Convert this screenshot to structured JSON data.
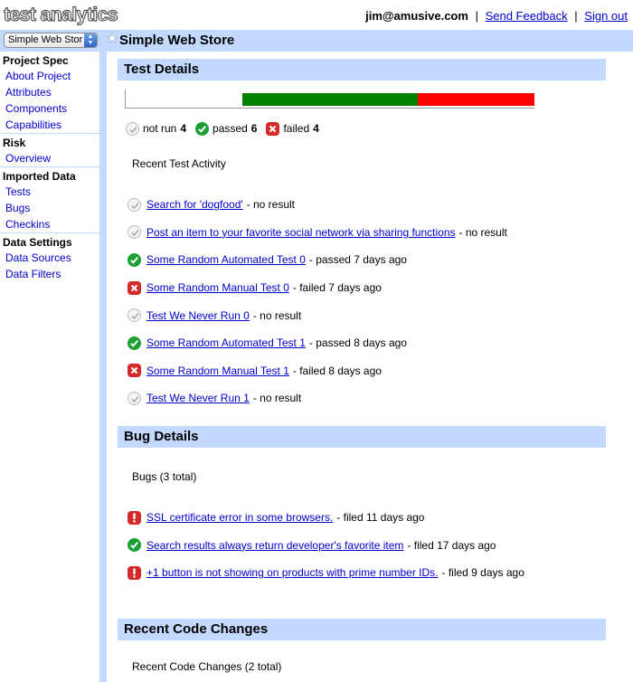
{
  "header": {
    "logo_text": "test analytics",
    "user_email": "jim@amusive.com",
    "send_feedback": "Send Feedback",
    "sign_out": "Sign out"
  },
  "titlebar": {
    "project_select_value": "Simple Web Stor",
    "project_title": "Simple Web Store"
  },
  "sidebar": {
    "sections": [
      {
        "title": "Project Spec",
        "items": [
          "About Project",
          "Attributes",
          "Components",
          "Capabilities"
        ]
      },
      {
        "title": "Risk",
        "items": [
          "Overview"
        ]
      },
      {
        "title": "Imported Data",
        "items": [
          "Tests",
          "Bugs",
          "Checkins"
        ]
      },
      {
        "title": "Data Settings",
        "items": [
          "Data Sources",
          "Data Filters"
        ]
      }
    ]
  },
  "test_details": {
    "heading": "Test Details",
    "progress": {
      "not_run": 4,
      "passed": 6,
      "failed": 4,
      "colors": {
        "not_run": "#ffffff",
        "passed": "#008000",
        "failed": "#ff0000"
      }
    },
    "counts": {
      "not_run_label": "not run",
      "not_run": "4",
      "passed_label": "passed",
      "passed": "6",
      "failed_label": "failed",
      "failed": "4"
    },
    "recent_label": "Recent Test Activity",
    "activities": [
      {
        "status": "notrun",
        "name": "Search for 'dogfood'",
        "desc": "- no result"
      },
      {
        "status": "notrun",
        "name": "Post an item to your favorite social network via sharing functions",
        "desc": "- no result"
      },
      {
        "status": "pass",
        "name": "Some Random Automated Test 0",
        "desc": "- passed 7 days ago"
      },
      {
        "status": "fail",
        "name": "Some Random Manual Test 0",
        "desc": "- failed 7 days ago"
      },
      {
        "status": "notrun",
        "name": "Test We Never Run 0",
        "desc": "- no result"
      },
      {
        "status": "pass",
        "name": "Some Random Automated Test 1",
        "desc": "- passed 8 days ago"
      },
      {
        "status": "fail",
        "name": "Some Random Manual Test 1",
        "desc": "- failed 8 days ago"
      },
      {
        "status": "notrun",
        "name": "Test We Never Run 1",
        "desc": "- no result"
      }
    ]
  },
  "bug_details": {
    "heading": "Bug Details",
    "summary": "Bugs (3 total)",
    "bugs": [
      {
        "status": "bug",
        "name": "SSL certificate error in some browsers.",
        "desc": "- filed 11 days ago"
      },
      {
        "status": "pass",
        "name": "Search results always return developer's favorite item",
        "desc": "- filed 17 days ago"
      },
      {
        "status": "bug",
        "name": "+1 button is not showing on products with prime number IDs.",
        "desc": "- filed 9 days ago"
      }
    ]
  },
  "code_changes": {
    "heading": "Recent Code Changes",
    "summary": "Recent Code Changes (2 total)"
  }
}
